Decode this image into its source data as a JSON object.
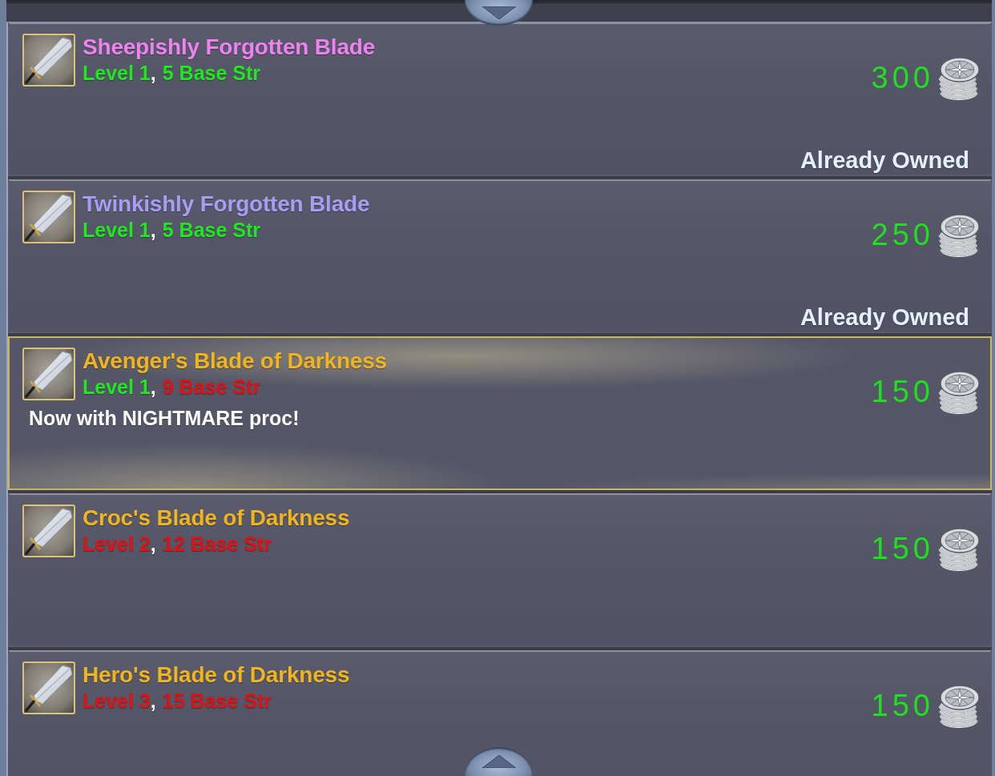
{
  "items": [
    {
      "name": "Sheepishly Forgotten Blade",
      "color": "#ee82ee",
      "level": {
        "text": "Level 1",
        "met": true
      },
      "separator": ",",
      "strength": {
        "text": "5 Base Str",
        "met": true
      },
      "price": "300",
      "status": "Already Owned",
      "selected": false
    },
    {
      "name": "Twinkishly Forgotten Blade",
      "color": "#a99cf2",
      "level": {
        "text": "Level 1",
        "met": true
      },
      "separator": ",",
      "strength": {
        "text": "5 Base Str",
        "met": true
      },
      "price": "250",
      "status": "Already Owned",
      "selected": false
    },
    {
      "name": "Avenger's Blade of Darkness",
      "color": "#f0b41e",
      "level": {
        "text": "Level 1",
        "met": true
      },
      "separator": ",",
      "strength": {
        "text": "9 Base Str",
        "met": false
      },
      "price": "150",
      "note": "Now with NIGHTMARE proc!",
      "selected": true
    },
    {
      "name": "Croc's Blade of Darkness",
      "color": "#f0b41e",
      "level": {
        "text": "Level 2",
        "met": false
      },
      "separator": ",",
      "strength": {
        "text": "12 Base Str",
        "met": false
      },
      "price": "150",
      "selected": false
    },
    {
      "name": "Hero's Blade of Darkness",
      "color": "#f0b41e",
      "level": {
        "text": "Level 3",
        "met": false
      },
      "separator": ",",
      "strength": {
        "text": "15 Base Str",
        "met": false
      },
      "price": "150",
      "selected": false
    }
  ]
}
